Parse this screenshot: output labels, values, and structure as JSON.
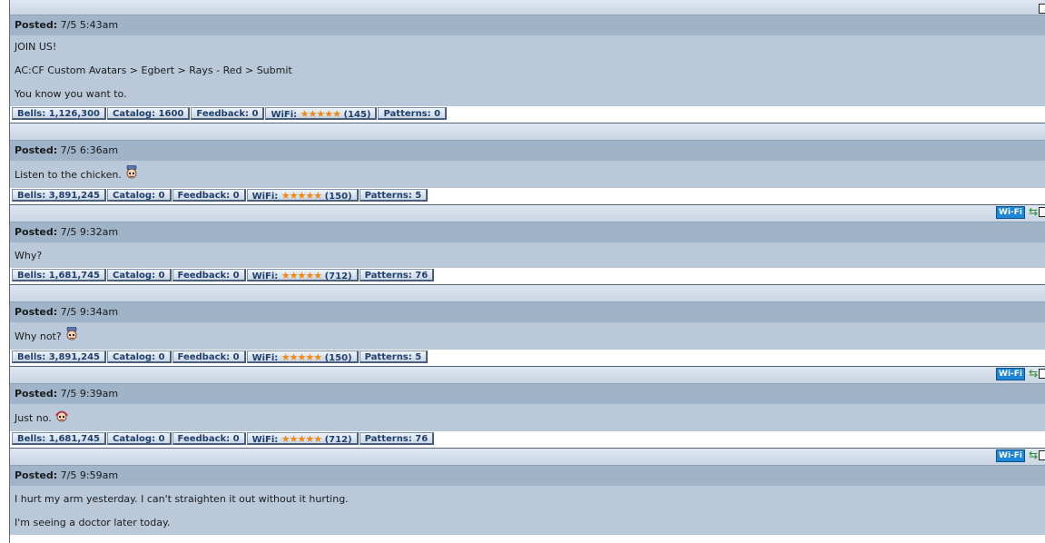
{
  "posts": [
    {
      "header_label": "Posted:",
      "time": "7/5 5:43am",
      "lines": [
        "JOIN US!",
        "AC:CF Custom Avatars > Egbert > Rays - Red > Submit",
        "You know you want to."
      ],
      "avatar": null,
      "top_icons": false,
      "stats": {
        "bells": "Bells: 1,126,300",
        "catalog": "Catalog: 1600",
        "feedback": "Feedback: 0",
        "wifi_label": "WiFi:",
        "wifi_stars": "★★★★★",
        "wifi_count": "(145)",
        "patterns": "Patterns: 0"
      }
    },
    {
      "header_label": "Posted:",
      "time": "7/5 6:36am",
      "lines": [
        "Listen to the chicken."
      ],
      "avatar": "chef-avatar-icon",
      "top_icons": false,
      "stats": {
        "bells": "Bells: 3,891,245",
        "catalog": "Catalog: 0",
        "feedback": "Feedback: 0",
        "wifi_label": "WiFi:",
        "wifi_stars": "★★★★★",
        "wifi_count": "(150)",
        "patterns": "Patterns: 5"
      }
    },
    {
      "header_label": "Posted:",
      "time": "7/5 9:32am",
      "lines": [
        "Why?"
      ],
      "avatar": null,
      "top_icons": true,
      "stats": {
        "bells": "Bells: 1,681,745",
        "catalog": "Catalog: 0",
        "feedback": "Feedback: 0",
        "wifi_label": "WiFi:",
        "wifi_stars": "★★★★★",
        "wifi_count": "(712)",
        "patterns": "Patterns: 76"
      }
    },
    {
      "header_label": "Posted:",
      "time": "7/5 9:34am",
      "lines": [
        "Why not?"
      ],
      "avatar": "chef-avatar-icon",
      "top_icons": false,
      "stats": {
        "bells": "Bells: 3,891,245",
        "catalog": "Catalog: 0",
        "feedback": "Feedback: 0",
        "wifi_label": "WiFi:",
        "wifi_stars": "★★★★★",
        "wifi_count": "(150)",
        "patterns": "Patterns: 5"
      }
    },
    {
      "header_label": "Posted:",
      "time": "7/5 9:39am",
      "lines": [
        "Just no."
      ],
      "avatar": "red-hair-avatar-icon",
      "top_icons": true,
      "stats": {
        "bells": "Bells: 1,681,745",
        "catalog": "Catalog: 0",
        "feedback": "Feedback: 0",
        "wifi_label": "WiFi:",
        "wifi_stars": "★★★★★",
        "wifi_count": "(712)",
        "patterns": "Patterns: 76"
      }
    },
    {
      "header_label": "Posted:",
      "time": "7/5 9:59am",
      "lines": [
        "I hurt my arm yesterday. I can't straighten it out without it hurting.",
        "I'm seeing a doctor later today."
      ],
      "avatar": null,
      "top_icons": true,
      "stats": null
    }
  ],
  "wifi_badge": "Wi-Fi",
  "sync_icon": "⇆",
  "colors": {
    "header_bg": "#9fb3c9",
    "body_bg": "#bac9da",
    "stat_text": "#213f6e",
    "star": "#ee8a12",
    "wifi_badge": "#1e86d8"
  }
}
